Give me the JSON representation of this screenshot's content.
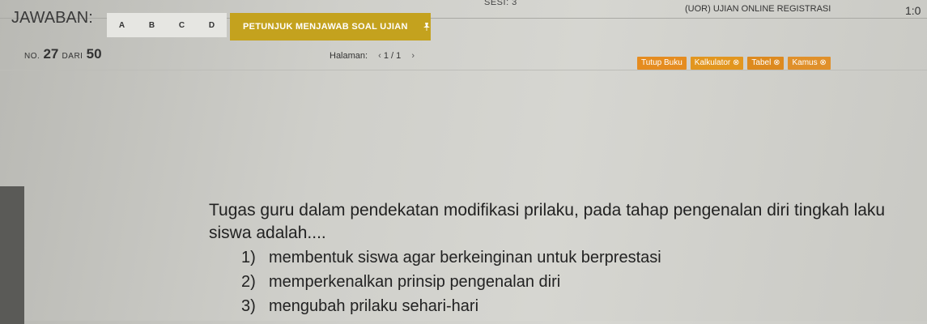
{
  "header": {
    "session": "SESI: 3",
    "exam_title": "(UOR) UJIAN ONLINE REGISTRASI",
    "timer": "1:0"
  },
  "answer_bar": {
    "label": "JAWABAN:",
    "options": [
      "A",
      "B",
      "C",
      "D"
    ],
    "instructions_button": "PETUNJUK MENJAWAB SOAL UJIAN"
  },
  "progress": {
    "no_label": "NO.",
    "current": "27",
    "of_label": "DARI",
    "total": "50"
  },
  "pagination": {
    "label": "Halaman:",
    "prev": "‹",
    "page": "1 / 1",
    "next": "›"
  },
  "tools": {
    "close_book": "Tutup Buku",
    "calculator": "Kalkulator ⊗",
    "table": "Tabel ⊗",
    "dictionary": "Kamus ⊗"
  },
  "question": {
    "text": "Tugas guru dalam pendekatan modifikasi prilaku, pada tahap pengenalan diri tingkah laku siswa adalah....",
    "statements": [
      {
        "num": "1)",
        "text": "membentuk siswa agar berkeinginan untuk berprestasi"
      },
      {
        "num": "2)",
        "text": "memperkenalkan prinsip pengenalan diri"
      },
      {
        "num": "3)",
        "text": "mengubah prilaku sehari-hari"
      }
    ]
  }
}
